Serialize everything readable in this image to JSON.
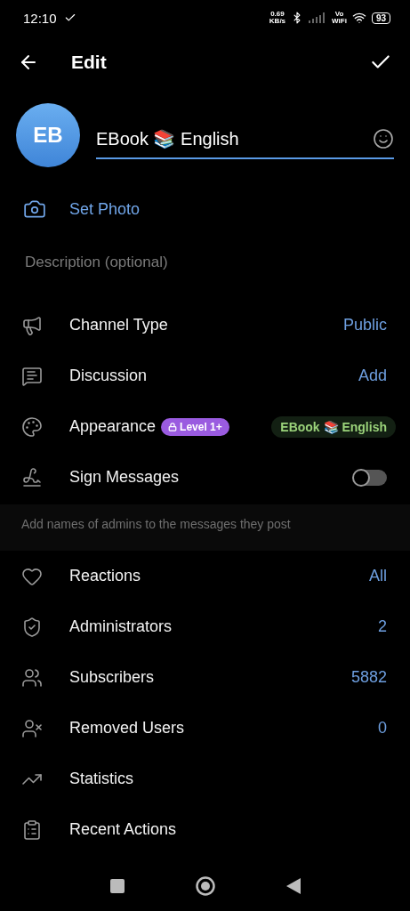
{
  "status_bar": {
    "time": "12:10",
    "speed_value": "0.69",
    "speed_unit": "KB/s",
    "vowifi_top": "Vo",
    "vowifi_bottom": "WiFi",
    "battery": "93"
  },
  "header": {
    "title": "Edit"
  },
  "profile": {
    "initials": "EB",
    "name": "EBook 📚 English"
  },
  "set_photo": "Set Photo",
  "description": {
    "placeholder": "Description (optional)"
  },
  "group_1": [
    {
      "kind": "value",
      "label": "Channel Type",
      "value": "Public"
    },
    {
      "kind": "value",
      "label": "Discussion",
      "value": "Add"
    },
    {
      "kind": "badge",
      "label": "Appearance",
      "badge": "Level 1+",
      "value": "EBook 📚 English"
    },
    {
      "kind": "toggle",
      "label": "Sign Messages",
      "on": false
    }
  ],
  "hint": "Add names of admins to the messages they post",
  "group_2": [
    {
      "kind": "value",
      "label": "Reactions",
      "value": "All"
    },
    {
      "kind": "value",
      "label": "Administrators",
      "value": "2"
    },
    {
      "kind": "value",
      "label": "Subscribers",
      "value": "5882"
    },
    {
      "kind": "value",
      "label": "Removed Users",
      "value": "0"
    },
    {
      "kind": "plain",
      "label": "Statistics"
    },
    {
      "kind": "plain",
      "label": "Recent Actions"
    }
  ]
}
